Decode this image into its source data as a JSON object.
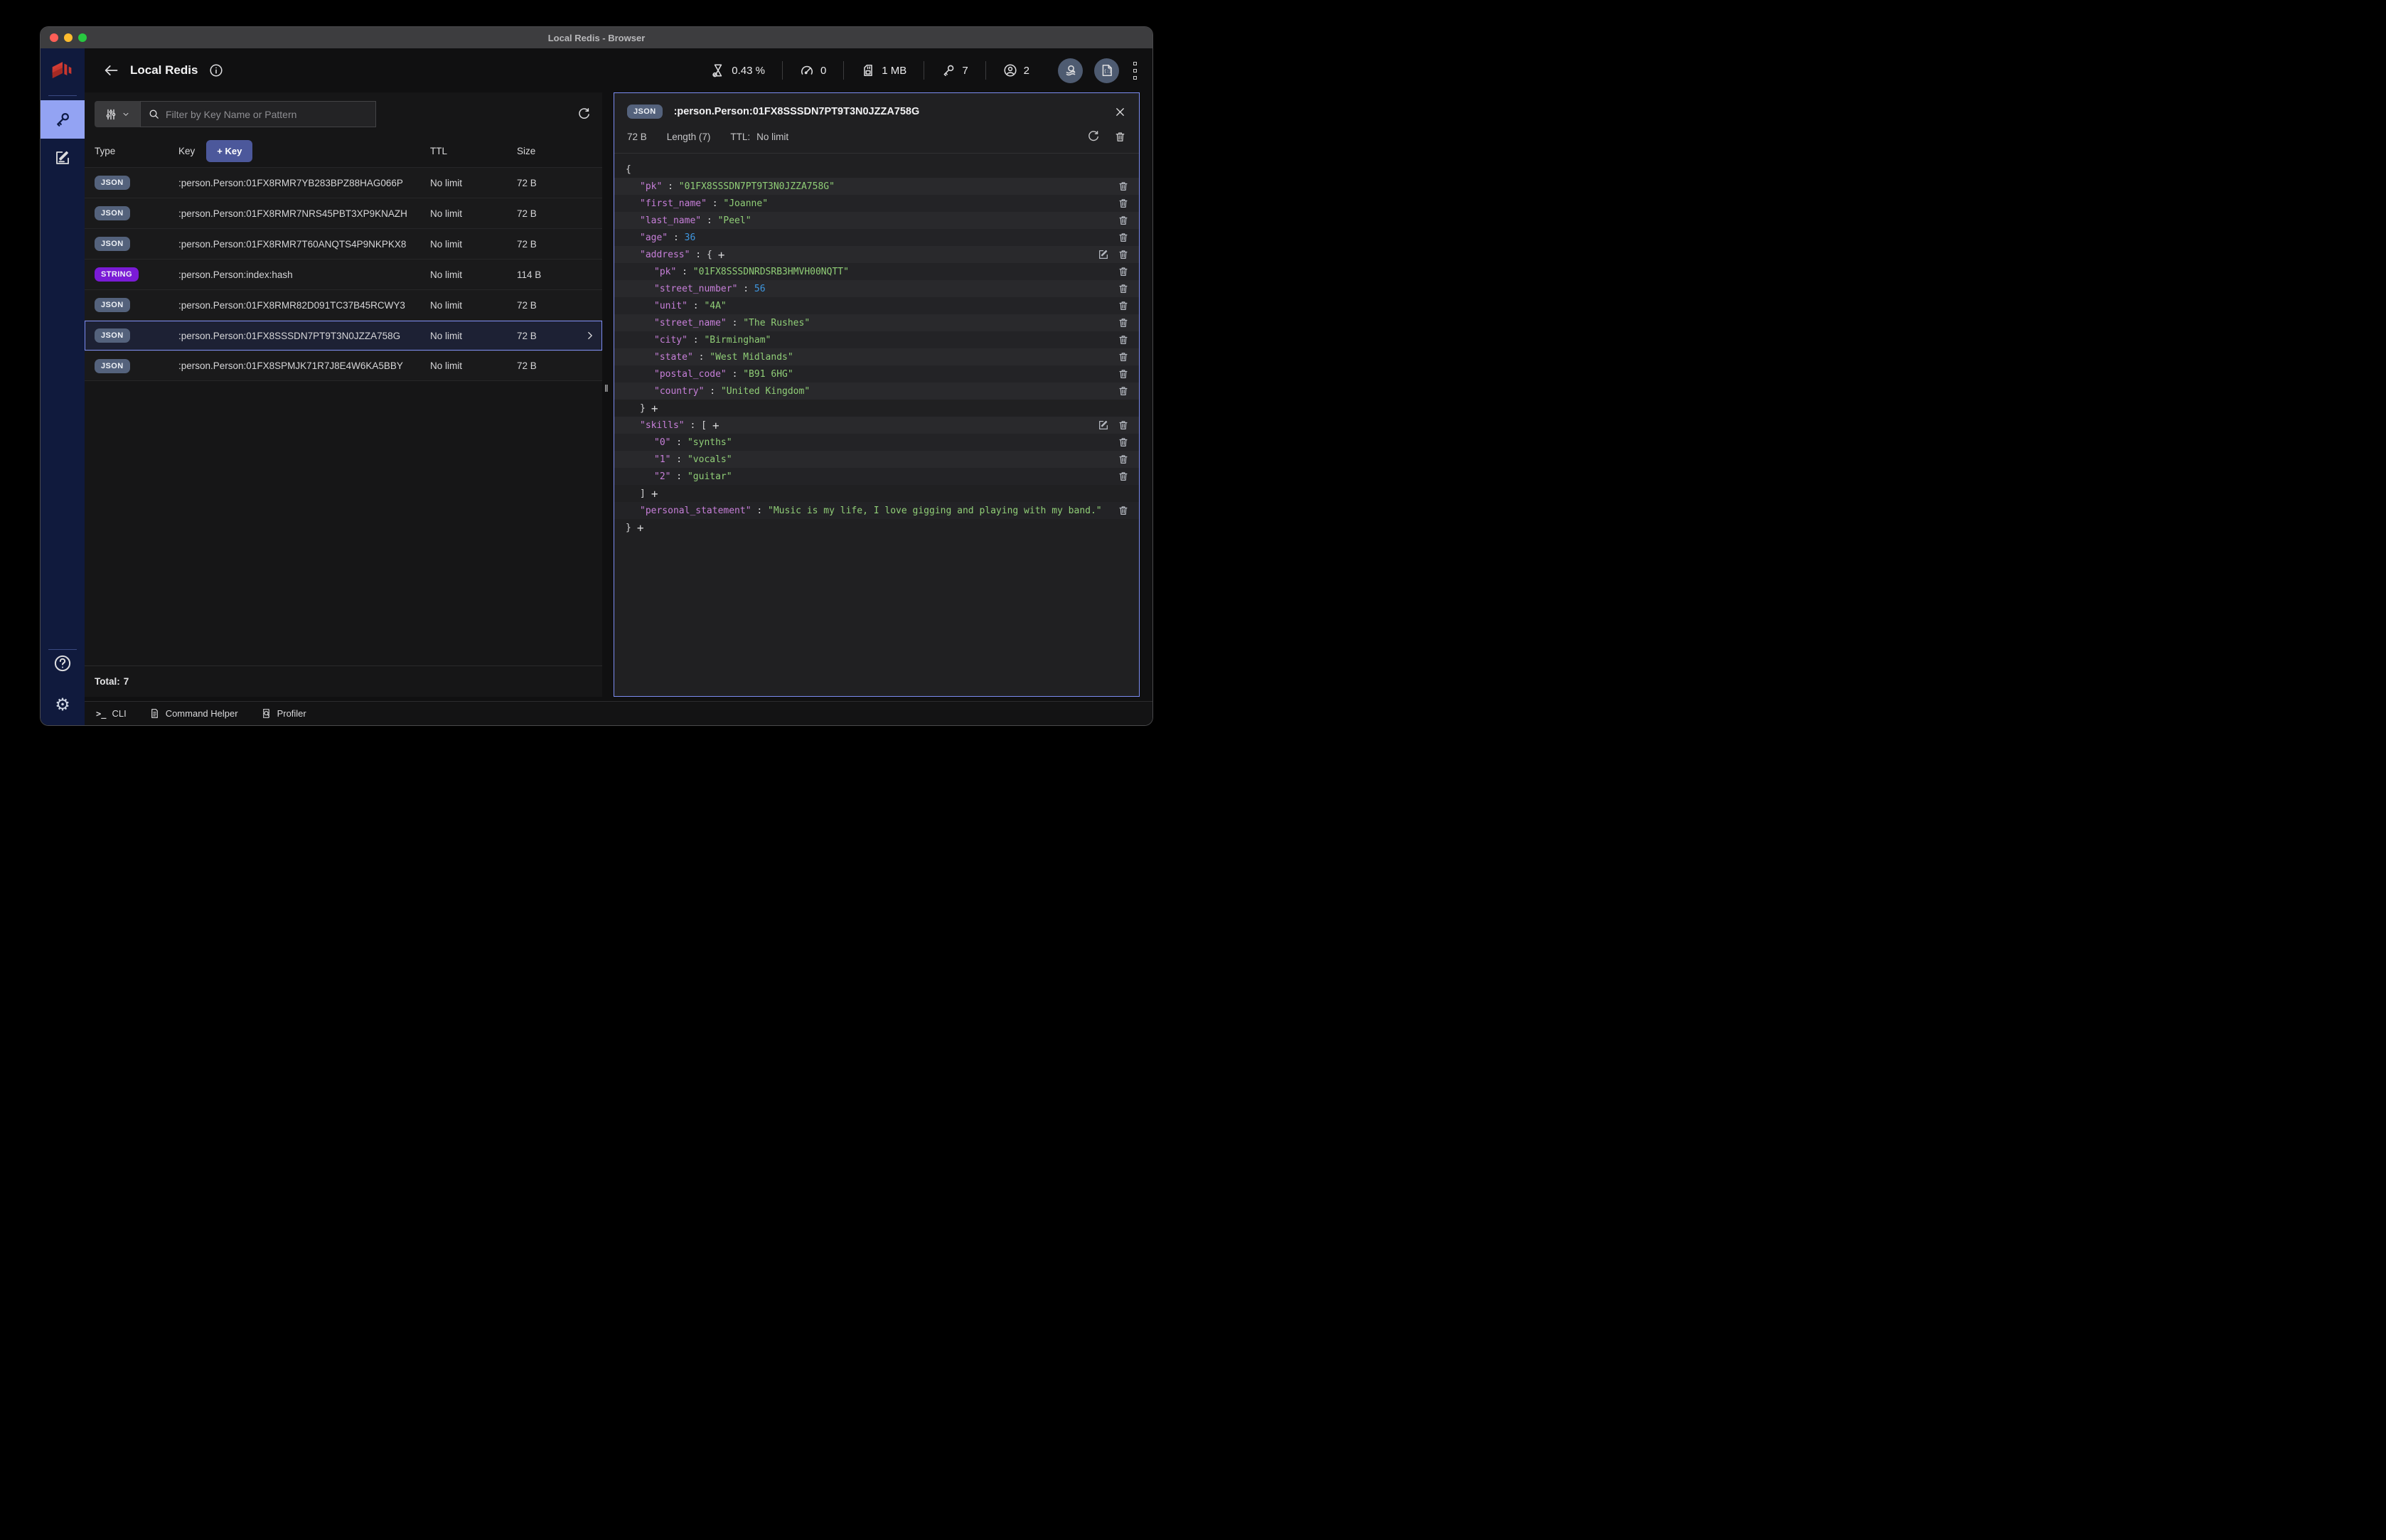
{
  "colors": {
    "accent": "#7d8df2",
    "badge-json": "#54627c",
    "badge-string": "#7a1bd6",
    "sidebar-active": "#93a3f3",
    "addkey": "#4c589b",
    "json-key": "#c77fd9",
    "json-string": "#90ce77",
    "json-number": "#3f97e0"
  },
  "window": {
    "title": "Local Redis - Browser"
  },
  "header": {
    "title": "Local Redis",
    "stats": {
      "cpu": "0.43 %",
      "commands": "0",
      "memory": "1 MB",
      "keys": "7",
      "users": "2"
    }
  },
  "browser": {
    "filter_placeholder": "Filter by Key Name or Pattern",
    "columns": {
      "type": "Type",
      "key": "Key",
      "ttl": "TTL",
      "size": "Size"
    },
    "add_key_label": "+ Key",
    "rows": [
      {
        "type": "JSON",
        "key": ":person.Person:01FX8RMR7YB283BPZ88HAG066P",
        "ttl": "No limit",
        "size": "72 B",
        "selected": false
      },
      {
        "type": "JSON",
        "key": ":person.Person:01FX8RMR7NRS45PBT3XP9KNAZH",
        "ttl": "No limit",
        "size": "72 B",
        "selected": false
      },
      {
        "type": "JSON",
        "key": ":person.Person:01FX8RMR7T60ANQTS4P9NKPKX8",
        "ttl": "No limit",
        "size": "72 B",
        "selected": false
      },
      {
        "type": "STRING",
        "key": ":person.Person:index:hash",
        "ttl": "No limit",
        "size": "114 B",
        "selected": false
      },
      {
        "type": "JSON",
        "key": ":person.Person:01FX8RMR82D091TC37B45RCWY3",
        "ttl": "No limit",
        "size": "72 B",
        "selected": false
      },
      {
        "type": "JSON",
        "key": ":person.Person:01FX8SSSDN7PT9T3N0JZZA758G",
        "ttl": "No limit",
        "size": "72 B",
        "selected": true
      },
      {
        "type": "JSON",
        "key": ":person.Person:01FX8SPMJK71R7J8E4W6KA5BBY",
        "ttl": "No limit",
        "size": "72 B",
        "selected": false
      }
    ],
    "total_label": "Total:",
    "total_value": "7"
  },
  "details": {
    "badge": "JSON",
    "key_name": ":person.Person:01FX8SSSDN7PT9T3N0JZZA758G",
    "size": "72 B",
    "length_label": "Length (7)",
    "ttl_label": "TTL:",
    "ttl_value": "No limit",
    "json_rows": [
      {
        "t": "open",
        "indent": 0,
        "bracket": "{"
      },
      {
        "t": "field",
        "indent": 1,
        "key": "pk",
        "value": "01FX8SSSDN7PT9T3N0JZZA758G",
        "vtype": "string"
      },
      {
        "t": "field",
        "indent": 1,
        "key": "first_name",
        "value": "Joanne",
        "vtype": "string"
      },
      {
        "t": "field",
        "indent": 1,
        "key": "last_name",
        "value": "Peel",
        "vtype": "string"
      },
      {
        "t": "field",
        "indent": 1,
        "key": "age",
        "value": "36",
        "vtype": "number"
      },
      {
        "t": "open-field",
        "indent": 1,
        "key": "address",
        "bracket": "{"
      },
      {
        "t": "field",
        "indent": 2,
        "key": "pk",
        "value": "01FX8SSSDNRDSRB3HMVH00NQTT",
        "vtype": "string"
      },
      {
        "t": "field",
        "indent": 2,
        "key": "street_number",
        "value": "56",
        "vtype": "number"
      },
      {
        "t": "field",
        "indent": 2,
        "key": "unit",
        "value": "4A",
        "vtype": "string"
      },
      {
        "t": "field",
        "indent": 2,
        "key": "street_name",
        "value": "The Rushes",
        "vtype": "string"
      },
      {
        "t": "field",
        "indent": 2,
        "key": "city",
        "value": "Birmingham",
        "vtype": "string"
      },
      {
        "t": "field",
        "indent": 2,
        "key": "state",
        "value": "West Midlands",
        "vtype": "string"
      },
      {
        "t": "field",
        "indent": 2,
        "key": "postal_code",
        "value": "B91 6HG",
        "vtype": "string"
      },
      {
        "t": "field",
        "indent": 2,
        "key": "country",
        "value": "United Kingdom",
        "vtype": "string"
      },
      {
        "t": "close",
        "indent": 1,
        "bracket": "}"
      },
      {
        "t": "open-field",
        "indent": 1,
        "key": "skills",
        "bracket": "["
      },
      {
        "t": "field",
        "indent": 2,
        "key": "0",
        "value": "synths",
        "vtype": "string"
      },
      {
        "t": "field",
        "indent": 2,
        "key": "1",
        "value": "vocals",
        "vtype": "string"
      },
      {
        "t": "field",
        "indent": 2,
        "key": "2",
        "value": "guitar",
        "vtype": "string"
      },
      {
        "t": "close",
        "indent": 1,
        "bracket": "]"
      },
      {
        "t": "field",
        "indent": 1,
        "key": "personal_statement",
        "value": "Music is my life, I love gigging and playing with my band.",
        "vtype": "string"
      },
      {
        "t": "close",
        "indent": 0,
        "bracket": "}"
      }
    ]
  },
  "footer": {
    "cli": "CLI",
    "command_helper": "Command Helper",
    "profiler": "Profiler"
  }
}
